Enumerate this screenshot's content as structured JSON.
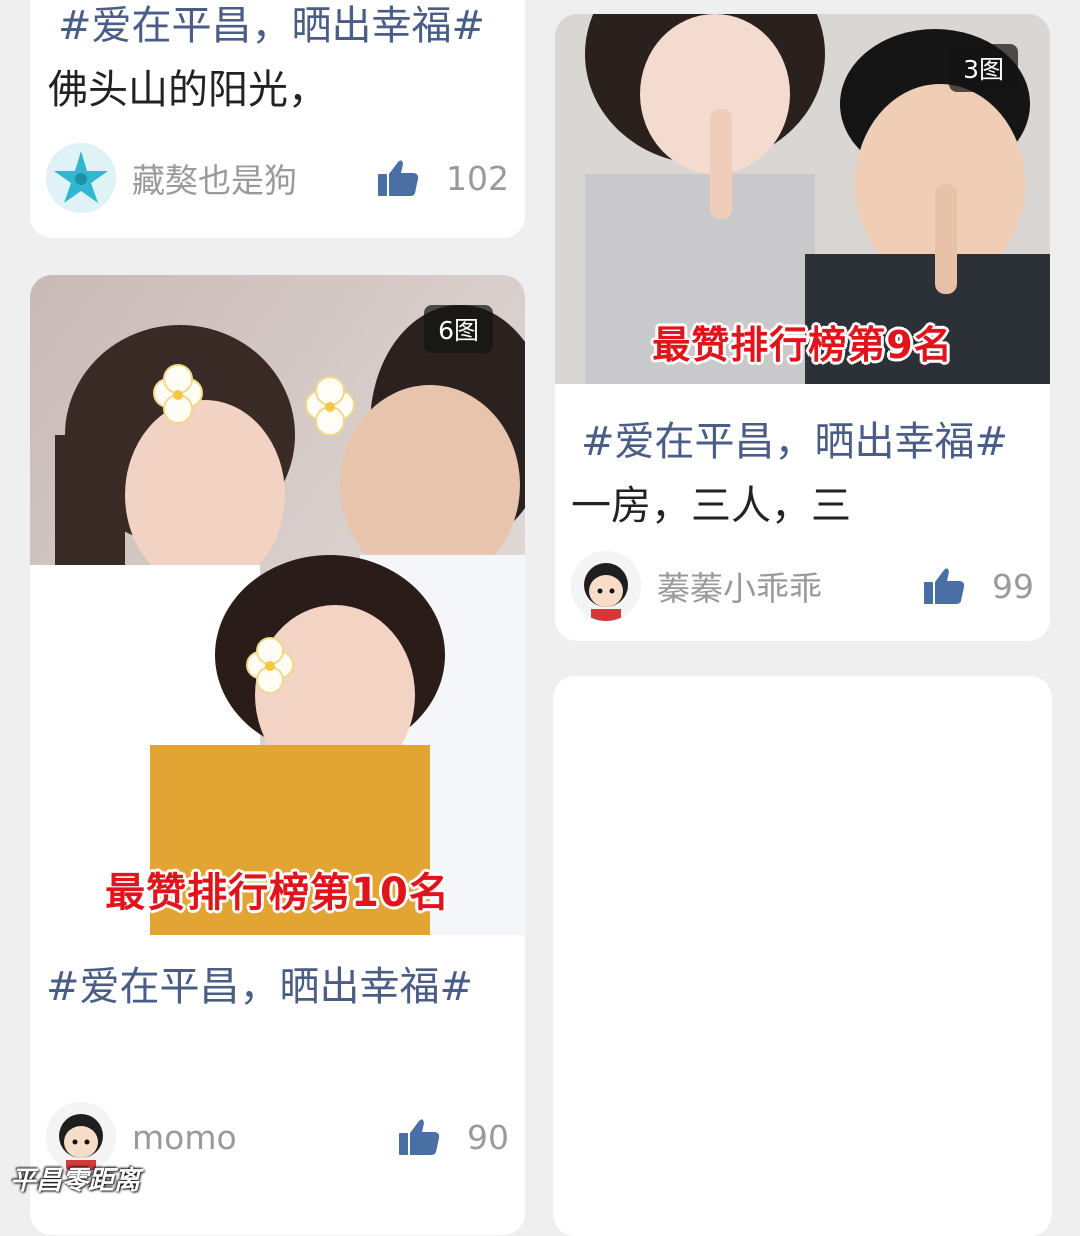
{
  "feed": {
    "cards": [
      {
        "tag": "#爱在平昌，晒出幸福#",
        "text": " 佛头山的阳光，",
        "author": "藏獒也是狗",
        "likes": "102"
      },
      {
        "image_count": "6图",
        "rank_banner": "最赞排行榜第10名",
        "tag": "#爱在平昌，晒出幸福#",
        "text": "",
        "author": "momo",
        "likes": "90"
      },
      {
        "image_count": "3图",
        "rank_banner": "最赞排行榜第9名",
        "tag": "#爱在平昌，晒出幸福#",
        "text": " 一房，三人，三",
        "author": "蓁蓁小乖乖",
        "likes": "99"
      }
    ]
  },
  "watermark": "平昌零距离",
  "icons": {
    "like": "thumbs-up-icon"
  },
  "colors": {
    "tag": "#4a5d86",
    "like_icon": "#4a6fa5",
    "rank_banner": "#e0141b",
    "background": "#efefef"
  }
}
